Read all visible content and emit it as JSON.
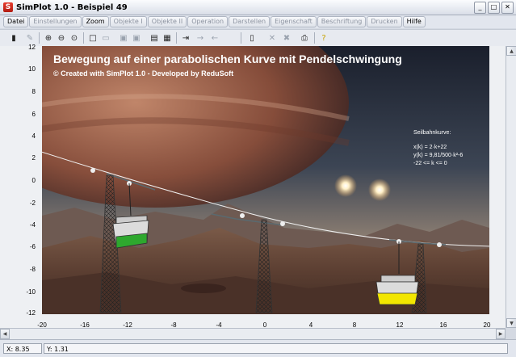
{
  "window": {
    "title": "SimPlot 1.0 - Beispiel 49",
    "app_icon_glyph": "S"
  },
  "menu": {
    "items": [
      {
        "label": "Datei",
        "enabled": true
      },
      {
        "label": "Einstellungen",
        "enabled": false
      },
      {
        "label": "Zoom",
        "enabled": true
      },
      {
        "label": "Objekte I",
        "enabled": false
      },
      {
        "label": "Objekte II",
        "enabled": false
      },
      {
        "label": "Operation",
        "enabled": false
      },
      {
        "label": "Darstellen",
        "enabled": false
      },
      {
        "label": "Eigenschaft",
        "enabled": false
      },
      {
        "label": "Beschriftung",
        "enabled": false
      },
      {
        "label": "Drucken",
        "enabled": false
      },
      {
        "label": "Hilfe",
        "enabled": true
      }
    ]
  },
  "toolbar": {
    "buttons": [
      "calculator-icon",
      "draw-icon",
      "zoom-in-icon",
      "zoom-out-icon",
      "zoom-reset-icon",
      "rectangle-icon",
      "ruler-icon",
      "copy-image-icon",
      "paste-image-icon",
      "table-icon",
      "screenshot-icon",
      "insert-icon",
      "arrow-right-icon",
      "arrow-left-icon",
      "document-icon",
      "cross-icon",
      "cross-alt-icon",
      "print-icon",
      "help-icon"
    ]
  },
  "scene": {
    "title": "Bewegung auf einer parabolischen Kurve mit Pendelschwingung",
    "credit": "© Created with SimPlot 1.0 - Developed by ReduSoft",
    "formula_title": "Seilbahnkurve:",
    "formula_lines": [
      "x(k) = 2·k+22",
      "y(k) = 9,81/500·k²-6",
      "-22 <= k <= 0"
    ]
  },
  "axes": {
    "y_ticks": [
      "12",
      "10",
      "8",
      "6",
      "4",
      "2",
      "0",
      "-2",
      "-4",
      "-6",
      "-8",
      "-10",
      "-12"
    ],
    "x_ticks": [
      "-20",
      "-16",
      "-12",
      "-8",
      "-4",
      "0",
      "4",
      "8",
      "12",
      "16",
      "20"
    ]
  },
  "status": {
    "x_label": "X: 8.35",
    "y_label": "Y: 1.31"
  },
  "colors": {
    "gondola_left": "#2ea82e",
    "gondola_right": "#f2e600",
    "accent": "#b21c12"
  }
}
